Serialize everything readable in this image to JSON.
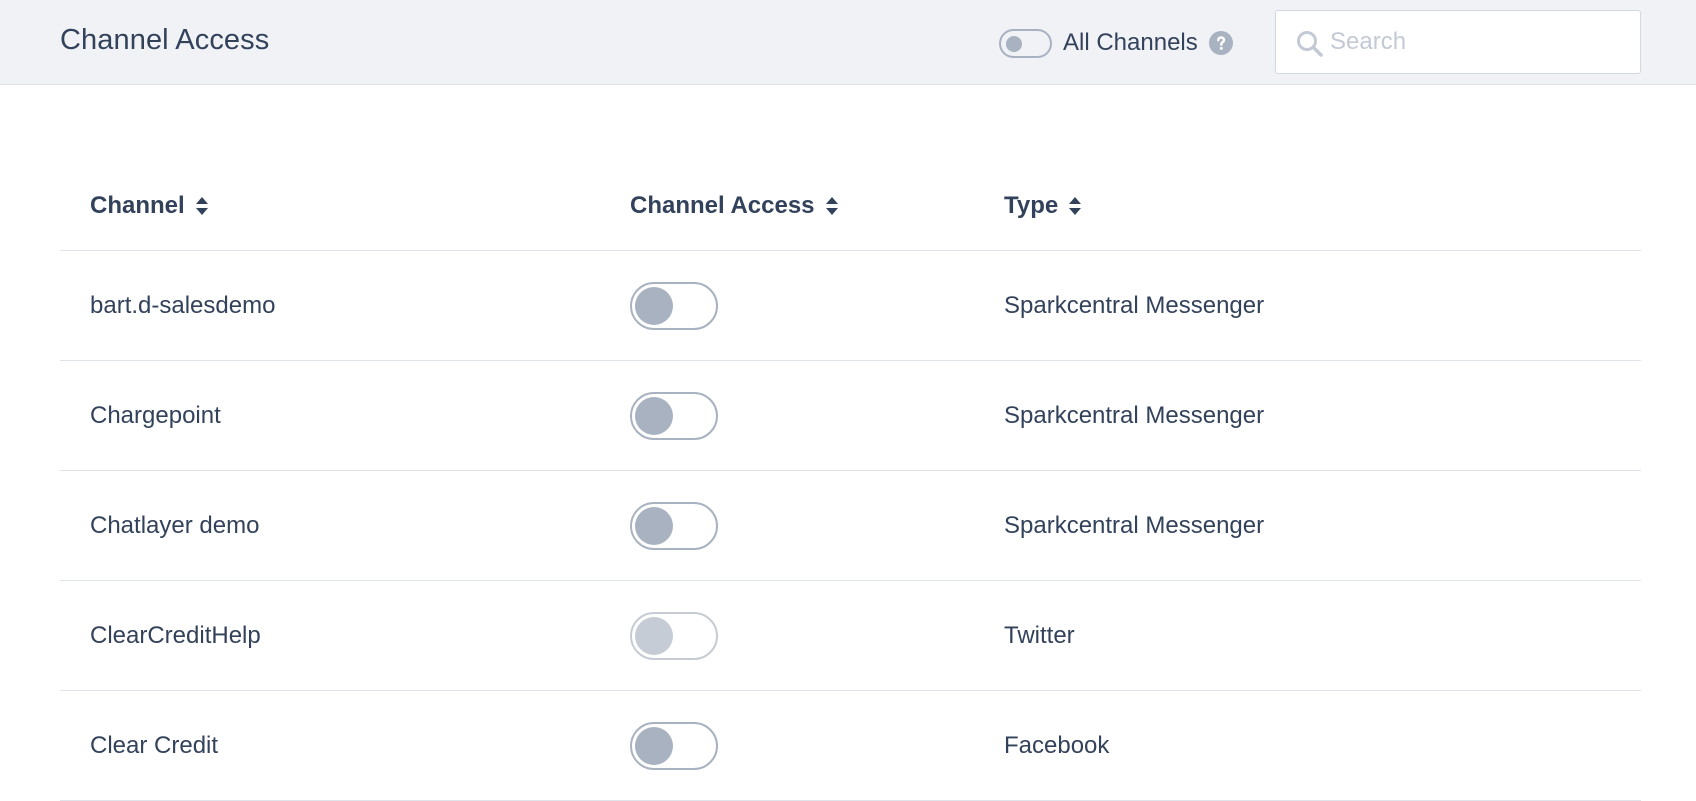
{
  "header": {
    "title": "Channel Access",
    "all_channels_label": "All Channels",
    "all_channels_enabled": false,
    "help_icon": "question-circle-icon",
    "search_placeholder": "Search",
    "search_value": ""
  },
  "table": {
    "columns": [
      {
        "label": "Channel",
        "icon": "sort-icon"
      },
      {
        "label": "Channel Access",
        "icon": "sort-icon"
      },
      {
        "label": "Type",
        "icon": "sort-icon"
      }
    ],
    "rows": [
      {
        "channel": "bart.d-salesdemo",
        "access": false,
        "disabled": false,
        "type": "Sparkcentral Messenger"
      },
      {
        "channel": "Chargepoint",
        "access": false,
        "disabled": false,
        "type": "Sparkcentral Messenger"
      },
      {
        "channel": "Chatlayer demo",
        "access": false,
        "disabled": false,
        "type": "Sparkcentral Messenger"
      },
      {
        "channel": "ClearCreditHelp",
        "access": false,
        "disabled": true,
        "type": "Twitter"
      },
      {
        "channel": "Clear Credit",
        "access": false,
        "disabled": false,
        "type": "Facebook"
      }
    ]
  },
  "colors": {
    "header_bg": "#f0f2f6",
    "text": "#33425b",
    "toggle_off": "#a8b2c1",
    "toggle_disabled": "#c5ccd6",
    "divider": "#dfe3ea"
  }
}
